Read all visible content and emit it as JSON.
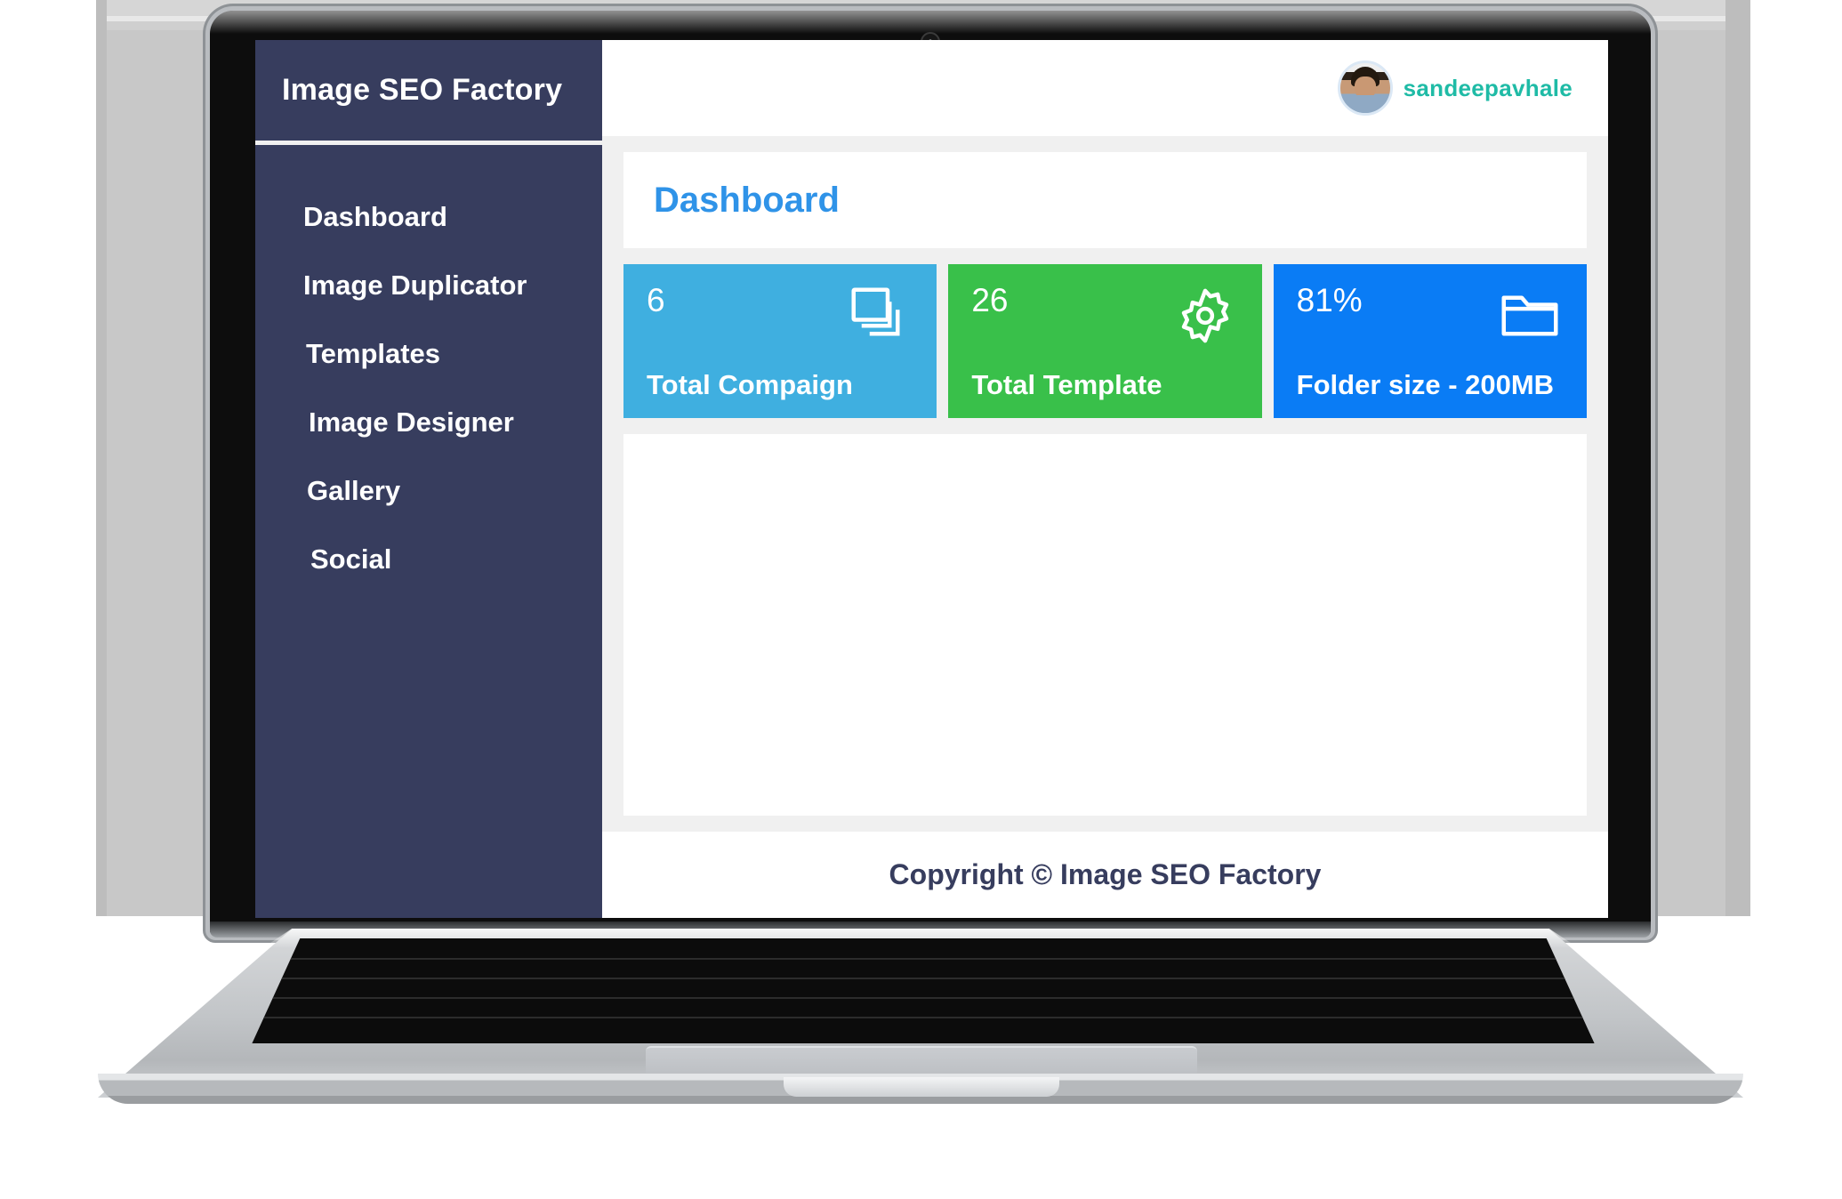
{
  "window": {
    "device": "laptop",
    "webcam_icon": "camera-icon"
  },
  "sidebar": {
    "brand": "Image SEO Factory",
    "items": [
      {
        "label": "Dashboard",
        "icon": "dashboard-icon"
      },
      {
        "label": "Image Duplicator",
        "icon": "duplicate-icon"
      },
      {
        "label": "Templates",
        "icon": "template-icon"
      },
      {
        "label": "Image Designer",
        "icon": "design-icon"
      },
      {
        "label": "Gallery",
        "icon": "gallery-icon"
      },
      {
        "label": "Social",
        "icon": "social-icon"
      }
    ]
  },
  "topbar": {
    "username": "sandeepavhale",
    "avatar_icon": "user-avatar"
  },
  "page": {
    "title": "Dashboard"
  },
  "cards": [
    {
      "value": "6",
      "label": "Total Compaign",
      "icon": "copy-stack-icon",
      "color": "#3fafe0"
    },
    {
      "value": "26",
      "label": "Total Template",
      "icon": "gear-icon",
      "color": "#39c04a"
    },
    {
      "value": "81%",
      "label": "Folder size - 200MB",
      "icon": "folder-icon",
      "color": "#0a7cf5"
    }
  ],
  "footer": {
    "copyright": "Copyright © Image SEO Factory"
  },
  "colors": {
    "sidebar_bg": "#373d5e",
    "content_bg": "#f0f0f0",
    "panel_bg": "#ffffff",
    "title_accent": "#2f93e8",
    "username_accent": "#1fbba6",
    "footer_text": "#373d5e"
  }
}
